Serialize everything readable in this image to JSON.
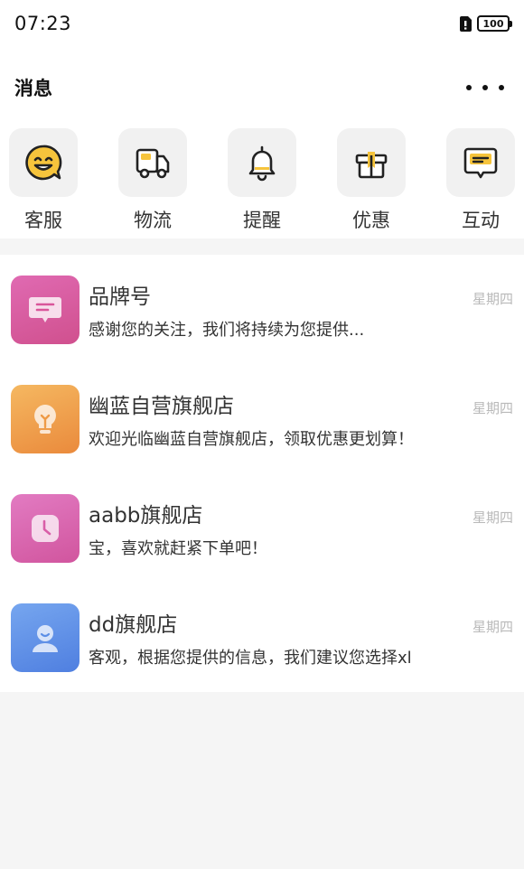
{
  "status": {
    "time": "07:23",
    "battery": "100"
  },
  "header": {
    "title": "消息"
  },
  "quick": [
    {
      "label": "客服",
      "icon": "smiley-face-icon"
    },
    {
      "label": "物流",
      "icon": "delivery-truck-icon"
    },
    {
      "label": "提醒",
      "icon": "bell-icon"
    },
    {
      "label": "优惠",
      "icon": "gift-box-icon"
    },
    {
      "label": "互动",
      "icon": "chat-bubble-icon"
    }
  ],
  "conversations": [
    {
      "name": "品牌号",
      "day": "星期四",
      "message": "感谢您的关注，我们将持续为您提供..."
    },
    {
      "name": "幽蓝自营旗舰店",
      "day": "星期四",
      "message": "欢迎光临幽蓝自营旗舰店，领取优惠更划算！"
    },
    {
      "name": "aabb旗舰店",
      "day": "星期四",
      "message": "宝，喜欢就赶紧下单吧！"
    },
    {
      "name": "dd旗舰店",
      "day": "星期四",
      "message": "客观，根据您提供的信息，我们建议您选择xl"
    }
  ],
  "colors": {
    "accent": "#f6c43c",
    "avatar_brand": "#d95fa3",
    "avatar_store1": "#f0a24c",
    "avatar_store2": "#dc68b4",
    "avatar_store3": "#5b8fe6"
  }
}
